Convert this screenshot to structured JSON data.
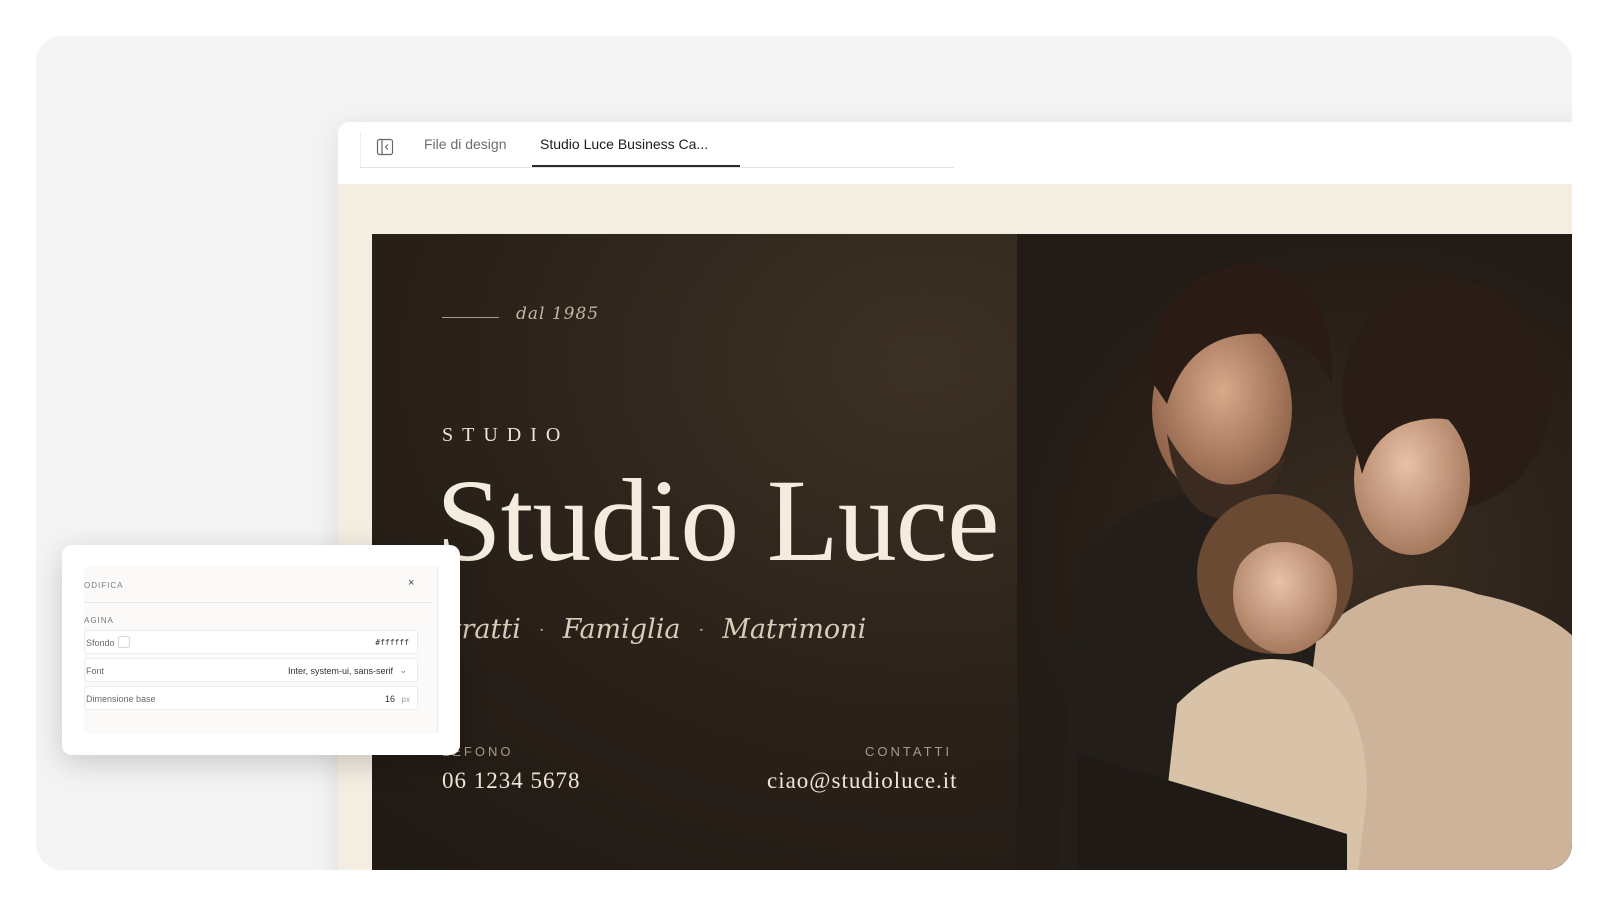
{
  "tabs": [
    {
      "label": "File di design",
      "active": false
    },
    {
      "label": "Studio Luce Business Ca...",
      "active": true
    }
  ],
  "card": {
    "since": "dal 1985",
    "eyebrow": "STUDIO",
    "title": "Studio Luce",
    "services": [
      "itratti",
      "Famiglia",
      "Matrimoni"
    ],
    "separator": "·",
    "phone_label": "LEFONO",
    "phone": "06 1234 5678",
    "contact_label": "CONTATTI",
    "email": "ciao@studioluce.it"
  },
  "panel": {
    "title": "ODIFICA",
    "close": "×",
    "section": "AGINA",
    "rows": {
      "background": {
        "label": "Sfondo",
        "value": "#ffffff"
      },
      "font": {
        "label": "Font",
        "value": "Inter, system-ui, sans-serif",
        "chevron": "⌄"
      },
      "base_size": {
        "label": "Dimensione base",
        "value": "16",
        "unit": "px"
      }
    }
  },
  "colors": {
    "canvas_bg": "#f3ede2",
    "card_bg": "#2b221a",
    "title_text": "#f3ecdf"
  }
}
